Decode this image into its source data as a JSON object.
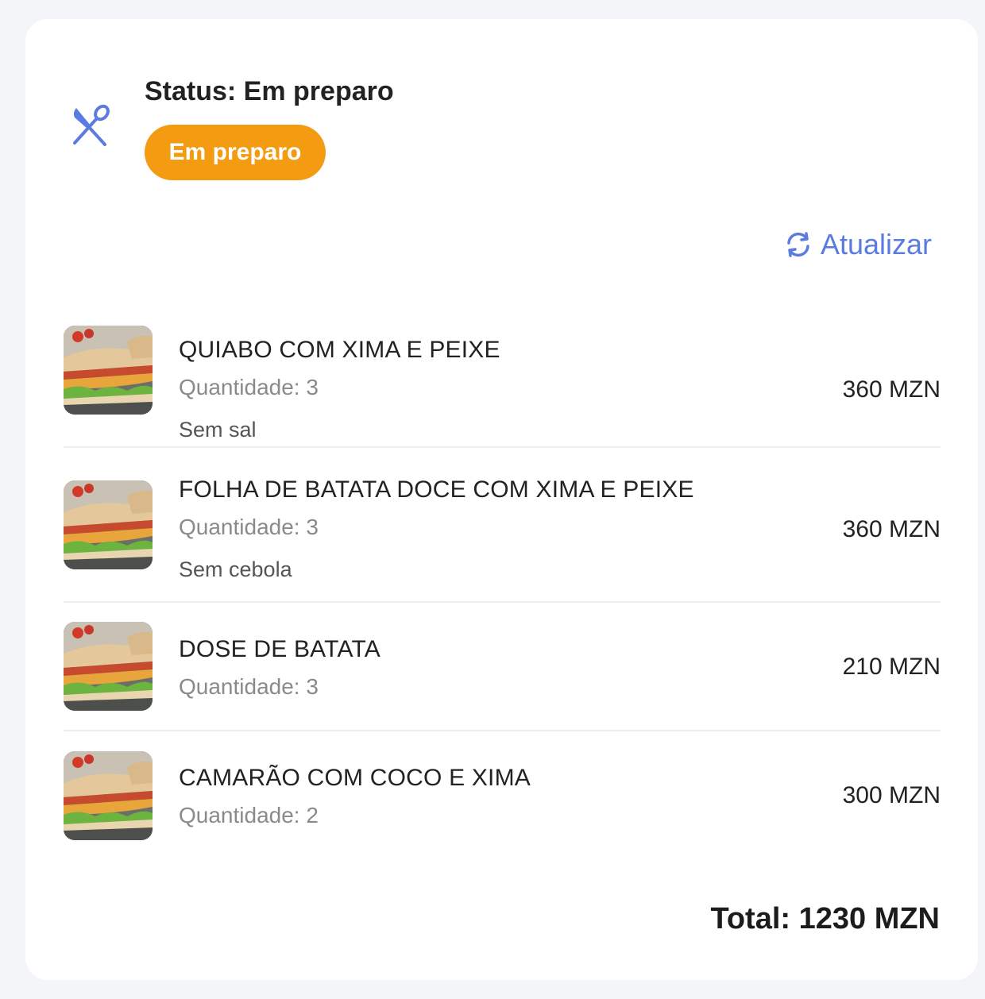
{
  "status": {
    "title": "Status: Em preparo",
    "badge": "Em preparo",
    "badge_color": "#f39c12",
    "icon": "utensils-icon"
  },
  "refresh": {
    "label": "Atualizar",
    "icon": "refresh-icon",
    "color": "#5b7be0"
  },
  "items": [
    {
      "name": "QUIABO COM XIMA E PEIXE",
      "quantity": "Quantidade: 3",
      "note": "Sem sal",
      "price": "360 MZN",
      "image": "sandwich-image"
    },
    {
      "name": "FOLHA DE BATATA DOCE COM XIMA E PEIXE",
      "quantity": "Quantidade: 3",
      "note": "Sem cebola",
      "price": "360 MZN",
      "image": "sandwich-image"
    },
    {
      "name": "DOSE DE BATATA",
      "quantity": "Quantidade: 3",
      "price": "210 MZN",
      "image": "sandwich-image"
    },
    {
      "name": "CAMARÃO COM COCO E XIMA",
      "quantity": "Quantidade: 2",
      "price": "300 MZN",
      "image": "sandwich-image"
    }
  ],
  "total": "Total: 1230 MZN"
}
